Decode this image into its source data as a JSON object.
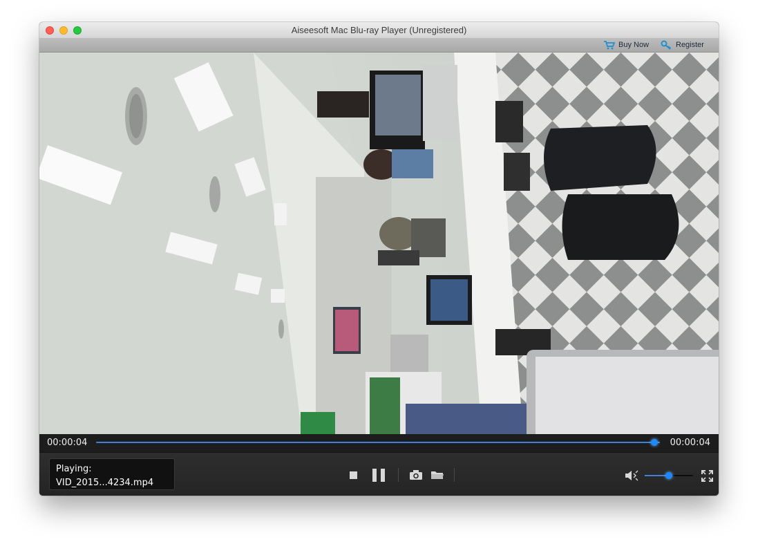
{
  "window": {
    "title": "Aiseesoft Mac Blu-ray Player (Unregistered)"
  },
  "toolbar": {
    "buy_label": "Buy Now",
    "register_label": "Register"
  },
  "playback": {
    "elapsed": "00:00:04",
    "duration": "00:00:04",
    "progress_fraction": 0.99,
    "volume_fraction": 0.5
  },
  "now_playing": {
    "label": "Playing:",
    "file": "VID_2015...4234.mp4"
  },
  "icons": {
    "buy": "cart-icon",
    "register": "key-icon",
    "stop": "stop-icon",
    "pause": "pause-icon",
    "snapshot": "camera-icon",
    "open": "folder-icon",
    "volume": "speaker-icon",
    "fullscreen": "fullscreen-icon"
  },
  "colors": {
    "accent": "#1e88ff",
    "control_bar": "#262626",
    "title_bar": "#e0e0e0"
  }
}
